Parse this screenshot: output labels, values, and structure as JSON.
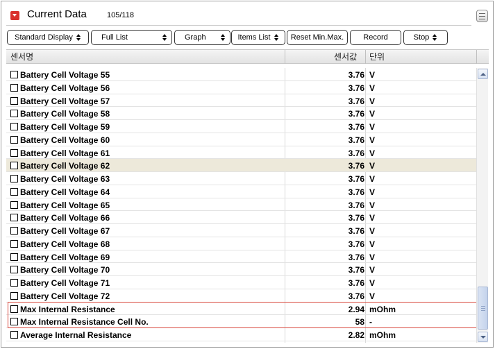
{
  "header": {
    "title": "Current Data",
    "count": "105/118"
  },
  "toolbar": {
    "standard_display": "Standard Display",
    "full_list": "Full List",
    "graph": "Graph",
    "items_list": "Items List",
    "reset_min_max": "Reset Min.Max.",
    "record": "Record",
    "stop": "Stop"
  },
  "columns": {
    "sensor_name": "센서명",
    "sensor_value": "센서값",
    "unit": "단위"
  },
  "rows": [
    {
      "name": "Battery Cell Voltage 55",
      "value": "3.76",
      "unit": "V"
    },
    {
      "name": "Battery Cell Voltage 56",
      "value": "3.76",
      "unit": "V"
    },
    {
      "name": "Battery Cell Voltage 57",
      "value": "3.76",
      "unit": "V"
    },
    {
      "name": "Battery Cell Voltage 58",
      "value": "3.76",
      "unit": "V"
    },
    {
      "name": "Battery Cell Voltage 59",
      "value": "3.76",
      "unit": "V"
    },
    {
      "name": "Battery Cell Voltage 60",
      "value": "3.76",
      "unit": "V"
    },
    {
      "name": "Battery Cell Voltage 61",
      "value": "3.76",
      "unit": "V"
    },
    {
      "name": "Battery Cell Voltage 62",
      "value": "3.76",
      "unit": "V"
    },
    {
      "name": "Battery Cell Voltage 63",
      "value": "3.76",
      "unit": "V"
    },
    {
      "name": "Battery Cell Voltage 64",
      "value": "3.76",
      "unit": "V"
    },
    {
      "name": "Battery Cell Voltage 65",
      "value": "3.76",
      "unit": "V"
    },
    {
      "name": "Battery Cell Voltage 66",
      "value": "3.76",
      "unit": "V"
    },
    {
      "name": "Battery Cell Voltage 67",
      "value": "3.76",
      "unit": "V"
    },
    {
      "name": "Battery Cell Voltage 68",
      "value": "3.76",
      "unit": "V"
    },
    {
      "name": "Battery Cell Voltage 69",
      "value": "3.76",
      "unit": "V"
    },
    {
      "name": "Battery Cell Voltage 70",
      "value": "3.76",
      "unit": "V"
    },
    {
      "name": "Battery Cell Voltage 71",
      "value": "3.76",
      "unit": "V"
    },
    {
      "name": "Battery Cell Voltage 72",
      "value": "3.76",
      "unit": "V"
    },
    {
      "name": "Max Internal Resistance",
      "value": "2.94",
      "unit": "mOhm"
    },
    {
      "name": "Max Internal Resistance Cell No.",
      "value": "58",
      "unit": "-"
    },
    {
      "name": "Average Internal Resistance",
      "value": "2.82",
      "unit": "mOhm"
    }
  ],
  "highlighted_row": 7,
  "colors": {
    "accent_red": "#d9302c",
    "row_highlight": "#ede9da",
    "outline_red": "#d8453a"
  }
}
